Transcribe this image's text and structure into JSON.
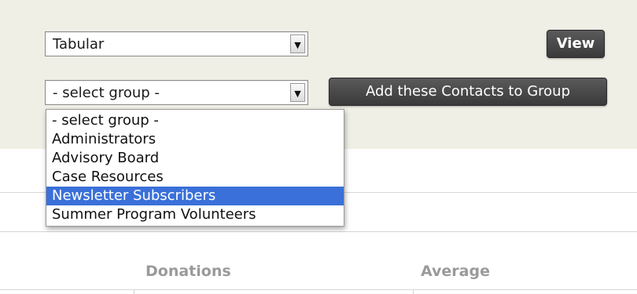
{
  "view_select": {
    "value": "Tabular"
  },
  "view_button": {
    "label": "View"
  },
  "group_select": {
    "value": "- select group -"
  },
  "add_button": {
    "label": "Add these Contacts to Group"
  },
  "group_dropdown": {
    "options": [
      "- select group -",
      "Administrators",
      "Advisory Board",
      "Case Resources",
      "Newsletter Subscribers",
      "Summer Program Volunteers"
    ],
    "highlighted_index": 4,
    "highlight_color": "#3a70d9"
  },
  "table": {
    "columns": [
      "Donations",
      "Average"
    ]
  },
  "icons": {
    "select_arrow": "chevron-down-icon"
  }
}
